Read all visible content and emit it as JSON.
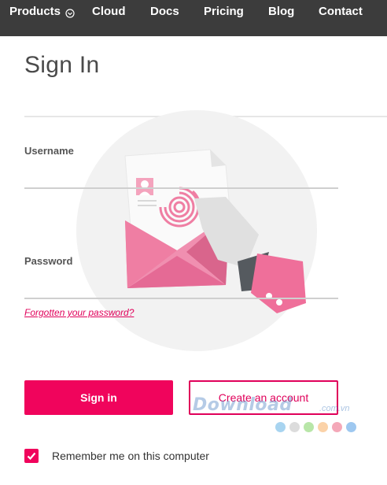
{
  "nav": {
    "items": [
      "Products",
      "Cloud",
      "Docs",
      "Pricing",
      "Blog",
      "Contact"
    ],
    "products_icon": "chevron-down-icon"
  },
  "page_title": "Sign In",
  "form": {
    "username_label": "Username",
    "username_value": "",
    "password_label": "Password",
    "password_value": "",
    "forgot_link": "Forgotten your password?",
    "signin_label": "Sign in",
    "create_label": "Create an account",
    "remember_label": "Remember me on this computer",
    "remember_checked": true
  },
  "watermark": {
    "text": "Download",
    "suffix": ".com.vn",
    "dot_colors": [
      "#a8d4f0",
      "#dcdcdc",
      "#b8e6a8",
      "#fbd2a8",
      "#f4a8b8",
      "#9ec8f0"
    ]
  },
  "colors": {
    "accent": "#f0045c",
    "nav_bg": "#3c3c3c",
    "illustration_pink": "#ef7ea3"
  }
}
